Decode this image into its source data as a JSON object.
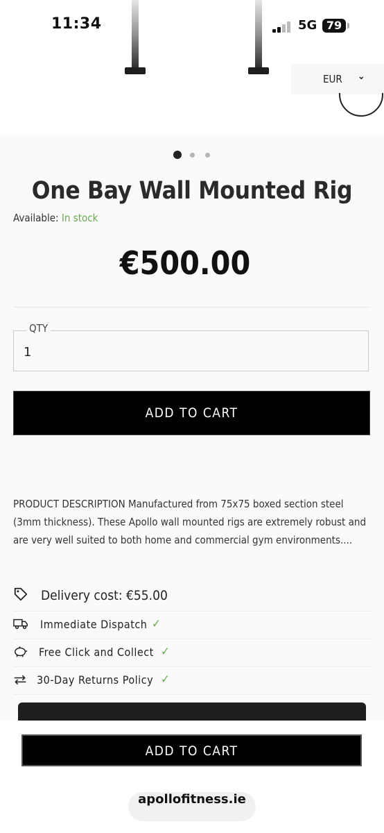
{
  "status_bar": {
    "time": "11:34",
    "network": "5G",
    "battery": "79"
  },
  "currency": {
    "selected": "EUR"
  },
  "gallery": {
    "slide_count": 3,
    "active_slide": 1
  },
  "product": {
    "title": "One Bay Wall Mounted Rig",
    "availability_label": "Available:",
    "availability_value": "In stock",
    "price": "€500.00"
  },
  "quantity": {
    "label": "QTY",
    "value": "1"
  },
  "buttons": {
    "add_to_cart": "ADD TO CART",
    "sticky_add_to_cart": "ADD TO CART"
  },
  "description": "PRODUCT DESCRIPTION Manufactured from 75x75 boxed section steel (3mm thickness). These Apollo wall mounted rigs are extremely robust and are very well suited to both home and commercial gym environments....",
  "features": {
    "delivery": "Delivery cost: €55.00",
    "items": [
      {
        "label": "Immediate Dispatch",
        "icon": "truck-icon"
      },
      {
        "label": "Free Click and Collect",
        "icon": "piggy-bank-icon"
      },
      {
        "label": "30-Day Returns Policy",
        "icon": "exchange-arrows-icon"
      }
    ]
  },
  "browser": {
    "url": "apollofitness.ie"
  },
  "colors": {
    "in_stock": "#6aa84f",
    "button_bg": "#000000",
    "check": "#6aa84f"
  }
}
